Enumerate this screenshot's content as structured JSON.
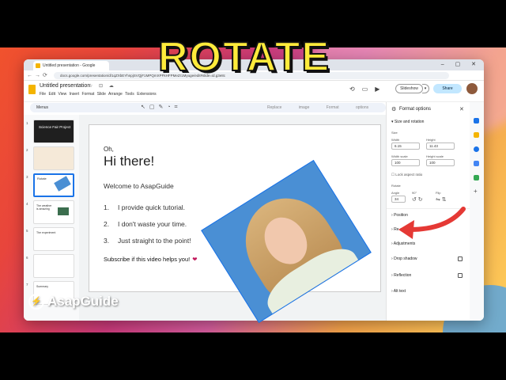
{
  "browser": {
    "tab_title": "Untitled presentation - Google",
    "window_controls": "– ▢ ✕",
    "url": "docs.google.com/presentation/d/1qZXbEYhnpjSVQjF1MPQmXPFkHFPMeZr1Myuge/edit#slide=id.g3e8c"
  },
  "app": {
    "doc_title": "Untitled presentation",
    "menus": [
      "File",
      "Edit",
      "View",
      "Insert",
      "Format",
      "Slide",
      "Arrange",
      "Tools",
      "Extensions"
    ],
    "slideshow_label": "Slideshow",
    "share_label": "Share",
    "toolbar_menus_label": "Menus",
    "toolbar_right_text": [
      "Replace image",
      "Format options"
    ]
  },
  "thumbnails": [
    {
      "num": "1",
      "title": "Science Fair Project"
    },
    {
      "num": "2",
      "title": ""
    },
    {
      "num": "3",
      "title": "Rotate"
    },
    {
      "num": "4",
      "title": "The weather is amazing"
    },
    {
      "num": "5",
      "title": "The experiment"
    },
    {
      "num": "6",
      "title": ""
    },
    {
      "num": "7",
      "title": "Summary"
    }
  ],
  "slide": {
    "oh": "Oh,",
    "heading": "Hi there!",
    "welcome": "Welcome to AsapGuide",
    "items": [
      {
        "n": "1.",
        "text": "I provide quick tutorial."
      },
      {
        "n": "2.",
        "text": "I don't waste your time."
      },
      {
        "n": "3.",
        "text": "Just straight to the point!"
      }
    ],
    "subscribe": "Subscribe if this video helps you!",
    "heart": "❤"
  },
  "format_panel": {
    "title": "Format options",
    "close": "✕",
    "size_rotation": "Size and rotation",
    "size": "Size",
    "width_label": "Width",
    "width": "6.15",
    "height_label": "Height",
    "height": "11.43",
    "width_scale_label": "Width scale",
    "width_scale": "100",
    "height_scale_label": "Height scale",
    "height_scale": "100",
    "lock_aspect": "Lock aspect ratio",
    "rotate": "Rotate",
    "angle_label": "Angle",
    "angle": "34",
    "ninety_label": "90°",
    "flip_label": "Flip",
    "sections": [
      "Position",
      "Re-colour",
      "Adjustments",
      "Drop shadow",
      "Reflection",
      "Alt text"
    ]
  },
  "overlay": {
    "title": "ROTATE",
    "brand": "AsapGuide",
    "arrow_color": "#e53935",
    "title_color": "#ffeb3b"
  },
  "colors": {
    "accent": "#1a73e8",
    "share_bg": "#c2e7ff",
    "doc_icon": "#f4b400"
  }
}
